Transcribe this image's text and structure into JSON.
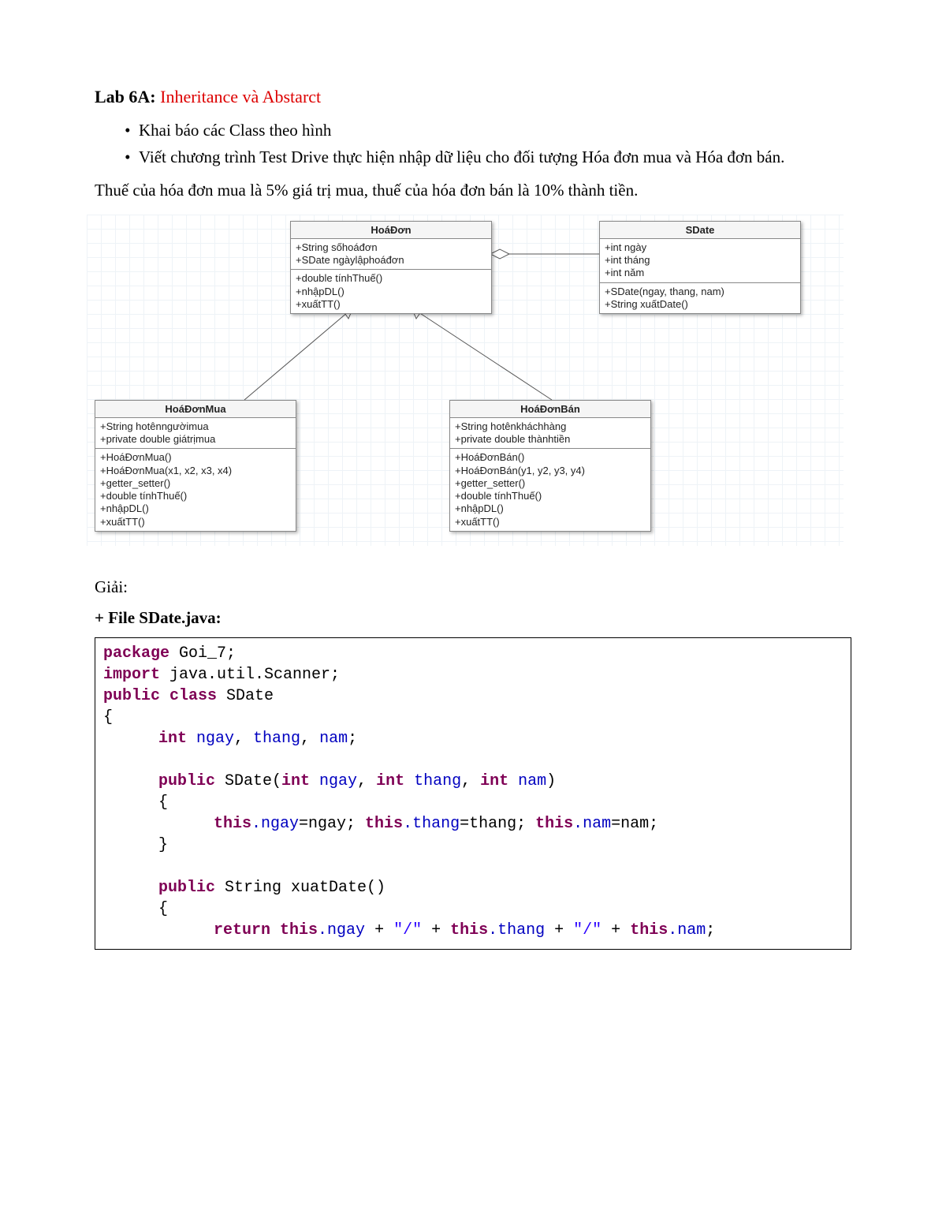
{
  "title": {
    "lab": "Lab 6A: ",
    "name": "Inheritance và Abstarct"
  },
  "bullets": [
    "Khai báo các Class theo hình",
    "Viết chương trình Test Drive thực hiện nhập dữ liệu cho đối tượng Hóa đơn mua và Hóa đơn bán."
  ],
  "para": "Thuế của hóa đơn mua là 5% giá trị mua, thuế của hóa đơn bán là 10% thành tiền.",
  "uml": {
    "HoaDon": {
      "title": "HoáĐơn",
      "attrs": [
        "+String sốhoáđơn",
        "+SDate ngàylậphoáđơn"
      ],
      "ops": [
        "+double tínhThuế()",
        "+nhậpDL()",
        "+xuấtTT()"
      ]
    },
    "SDate": {
      "title": "SDate",
      "attrs": [
        "+int ngày",
        "+int tháng",
        "+int năm"
      ],
      "ops": [
        "+SDate(ngay, thang, nam)",
        "+String xuấtDate()"
      ]
    },
    "HoaDonMua": {
      "title": "HoáĐơnMua",
      "attrs": [
        "+String hotênngườimua",
        "+private double giátrịmua"
      ],
      "ops": [
        "+HoáĐơnMua()",
        "+HoáĐơnMua(x1, x2, x3, x4)",
        "+getter_setter()",
        "+double tínhThuế()",
        "+nhậpDL()",
        "+xuấtTT()"
      ]
    },
    "HoaDonBan": {
      "title": "HoáĐơnBán",
      "attrs": [
        "+String hotênkháchhàng",
        "+private double thànhtiền"
      ],
      "ops": [
        "+HoáĐơnBán()",
        "+HoáĐơnBán(y1, y2, y3, y4)",
        "+getter_setter()",
        "+double tínhThuế()",
        "+nhậpDL()",
        "+xuấtTT()"
      ]
    }
  },
  "solution_label": "Giải:",
  "file_label": "+ File SDate.java:",
  "code": {
    "l1_pkg": "package",
    "l1_pkgn": " Goi_7;",
    "l2_imp": "import",
    "l2_impn": " java.util.Scanner;",
    "l3_pub": "public",
    "l3_cls": " class",
    "l3_name": " SDate",
    "l4_brace": "{",
    "l5_int": "int",
    "l5_vars": " ngay",
    "l5_c1": ", ",
    "l5_thang": "thang",
    "l5_c2": ", ",
    "l5_nam": "nam",
    "l5_end": ";",
    "l7_pub": "public",
    "l7_name": " SDate(",
    "l7_int1": "int",
    "l7_a1": " ngay",
    "l7_c1": ", ",
    "l7_int2": "int",
    "l7_a2": " thang",
    "l7_c2": ", ",
    "l7_int3": "int",
    "l7_a3": " nam",
    "l7_end": ")",
    "l8_brace": "{",
    "l9_this1": "this",
    "l9_a1": ".ngay",
    "l9_eq1": "=ngay; ",
    "l9_this2": "this",
    "l9_a2": ".thang",
    "l9_eq2": "=thang; ",
    "l9_this3": "this",
    "l9_a3": ".nam",
    "l9_eq3": "=nam;",
    "l10_brace": "}",
    "l12_pub": "public",
    "l12_str": " String xuatDate()",
    "l13_brace": "{",
    "l14_ret": "return",
    "l14_sp": " ",
    "l14_this1": "this",
    "l14_p1": ".ngay",
    "l14_plus1": " + ",
    "l14_s1": "\"/\"",
    "l14_plus2": " + ",
    "l14_this2": "this",
    "l14_p2": ".thang",
    "l14_plus3": " + ",
    "l14_s2": "\"/\"",
    "l14_plus4": " + ",
    "l14_this3": "this",
    "l14_p3": ".nam",
    "l14_end": ";"
  }
}
